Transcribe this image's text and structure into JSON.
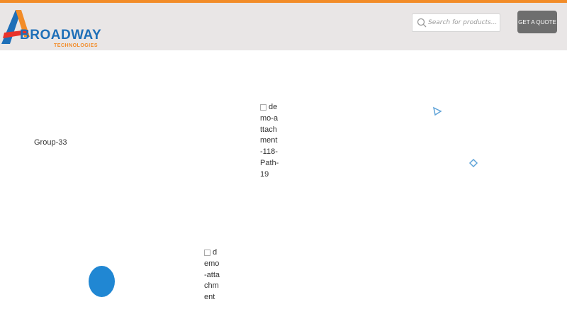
{
  "brand": {
    "name": "BROADWAY",
    "tagline": "TECHNOLOGIES",
    "primary_color": "#1e6fb8",
    "accent_color": "#f28c28"
  },
  "header": {
    "search_placeholder": "Search for products...",
    "quote_button": "GET A QUOTE"
  },
  "main": {
    "group_label": "Group-33",
    "images": [
      {
        "alt": "demo-attachment-118-Path-19"
      },
      {
        "alt": "demo-attachment"
      }
    ]
  },
  "decorations": {
    "circle_color": "#2087d3",
    "outline_color": "#5fa3d8"
  }
}
